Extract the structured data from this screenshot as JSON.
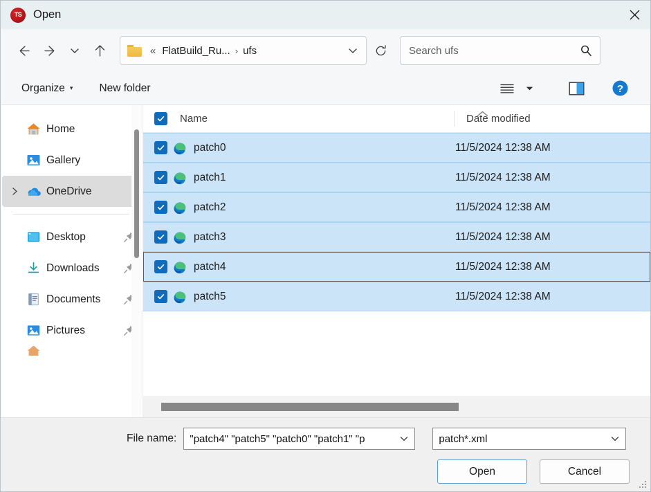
{
  "window": {
    "title": "Open",
    "app_icon": "app-icon",
    "close_label": "✕"
  },
  "nav": {
    "back_icon": "back-arrow-icon",
    "forward_icon": "forward-arrow-icon",
    "recent_icon": "chevron-down-icon",
    "up_icon": "up-arrow-icon",
    "refresh_icon": "refresh-icon",
    "breadcrumb": {
      "overflow": "«",
      "items": [
        "FlatBuild_Ru...",
        "ufs"
      ],
      "separator": "›"
    }
  },
  "search": {
    "placeholder": "Search ufs",
    "value": "",
    "icon": "search-icon"
  },
  "commandbar": {
    "organize_label": "Organize",
    "organize_caret": "▾",
    "new_folder_label": "New folder",
    "view_icon": "view-list-icon",
    "view_caret_icon": "chevron-down-icon",
    "preview_pane_icon": "preview-pane-icon",
    "help_icon": "help-icon",
    "help_glyph": "?"
  },
  "sidebar": {
    "items": [
      {
        "label": "Home",
        "icon": "home-icon",
        "expandable": false,
        "selected": false,
        "pinned": false
      },
      {
        "label": "Gallery",
        "icon": "gallery-icon",
        "expandable": false,
        "selected": false,
        "pinned": false
      },
      {
        "label": "OneDrive",
        "icon": "onedrive-icon",
        "expandable": true,
        "selected": true,
        "pinned": false
      },
      {
        "label": "Desktop",
        "icon": "desktop-icon",
        "expandable": false,
        "selected": false,
        "pinned": true
      },
      {
        "label": "Downloads",
        "icon": "downloads-icon",
        "expandable": false,
        "selected": false,
        "pinned": true
      },
      {
        "label": "Documents",
        "icon": "documents-icon",
        "expandable": false,
        "selected": false,
        "pinned": true
      },
      {
        "label": "Pictures",
        "icon": "pictures-icon",
        "expandable": false,
        "selected": false,
        "pinned": true
      }
    ],
    "expand_icon": "chevron-right-icon",
    "pin_icon": "pin-icon",
    "scrollbar": "vertical-scrollbar"
  },
  "filelist": {
    "columns": {
      "select_all_checkbox": "select-all-checkbox",
      "name": "Name",
      "date_modified": "Date modified",
      "sort_indicator": "sort-ascending-icon"
    },
    "rows": [
      {
        "name": "patch0",
        "date": "11/5/2024 12:38 AM",
        "checked": true,
        "icon": "edge-file-icon",
        "focused": false
      },
      {
        "name": "patch1",
        "date": "11/5/2024 12:38 AM",
        "checked": true,
        "icon": "edge-file-icon",
        "focused": false
      },
      {
        "name": "patch2",
        "date": "11/5/2024 12:38 AM",
        "checked": true,
        "icon": "edge-file-icon",
        "focused": false
      },
      {
        "name": "patch3",
        "date": "11/5/2024 12:38 AM",
        "checked": true,
        "icon": "edge-file-icon",
        "focused": false
      },
      {
        "name": "patch4",
        "date": "11/5/2024 12:38 AM",
        "checked": true,
        "icon": "edge-file-icon",
        "focused": true
      },
      {
        "name": "patch5",
        "date": "11/5/2024 12:38 AM",
        "checked": true,
        "icon": "edge-file-icon",
        "focused": false
      }
    ],
    "horizontal_scrollbar": "horizontal-scrollbar"
  },
  "footer": {
    "filename_label": "File name:",
    "filename_value": "\"patch4\" \"patch5\" \"patch0\" \"patch1\" \"p",
    "filename_placeholder": "File name",
    "filter_value": "patch*.xml",
    "combo_caret": "chevron-down-icon",
    "open_label": "Open",
    "cancel_label": "Cancel"
  },
  "colors": {
    "accent": "#0f6cbd",
    "selection": "#cce4f7",
    "selection_border": "#a9d3ef",
    "titlebar": "#e8f0f2",
    "chrome": "#f6f7f8",
    "footer": "#f0f0f0"
  }
}
